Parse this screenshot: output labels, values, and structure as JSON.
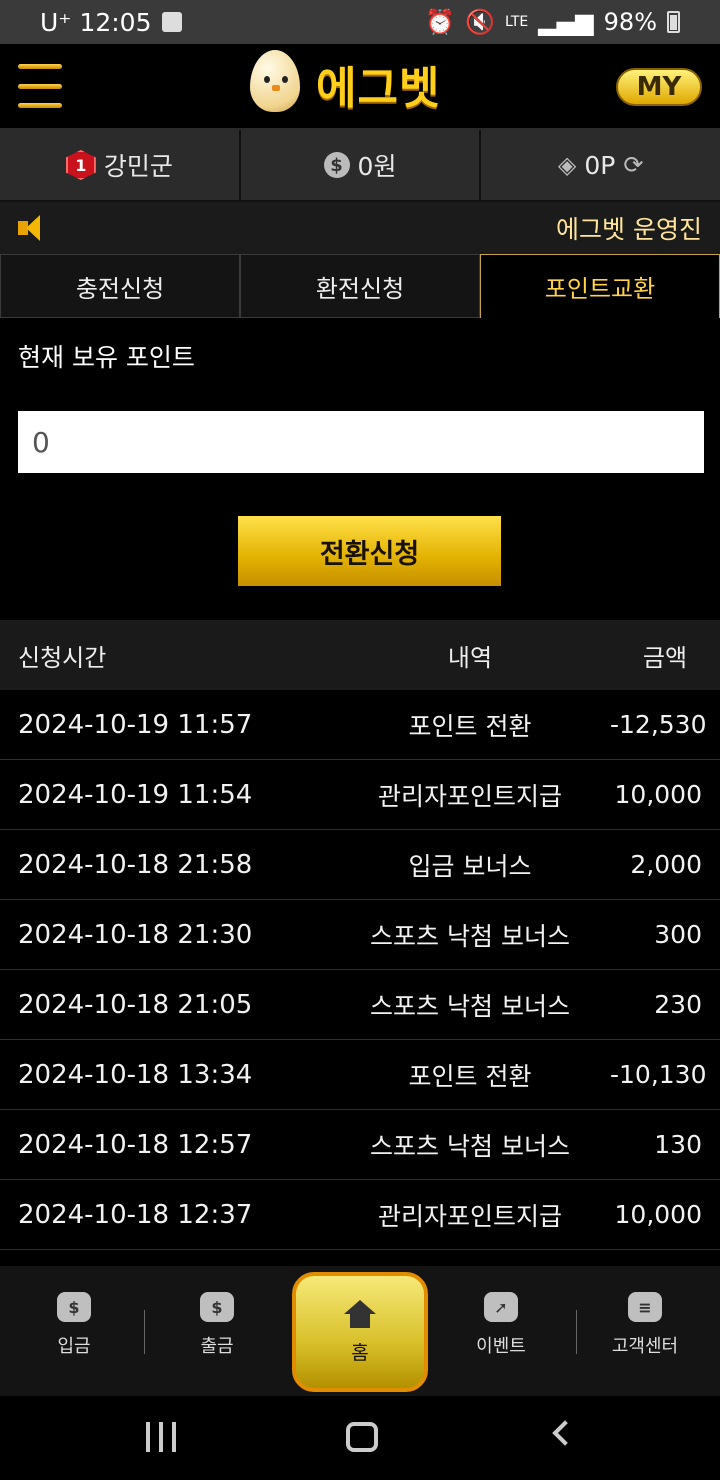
{
  "status_bar": {
    "carrier_time": "U⁺ 12:05",
    "network": "LTE",
    "battery": "98%"
  },
  "header": {
    "logo_text": "에그벳",
    "my_label": "MY"
  },
  "user_info": {
    "level": "1",
    "username": "강민군",
    "money": "0원",
    "points": "0P"
  },
  "notice": {
    "text": "에그벳 운영진"
  },
  "tabs": [
    {
      "label": "충전신청",
      "active": false
    },
    {
      "label": "환전신청",
      "active": false
    },
    {
      "label": "포인트교환",
      "active": true
    }
  ],
  "points_section": {
    "label": "현재 보유 포인트",
    "value": "0",
    "button_label": "전환신청"
  },
  "table": {
    "headers": [
      "신청시간",
      "내역",
      "금액"
    ],
    "rows": [
      {
        "date": "2024-10-19 11:57",
        "desc": "포인트 전환",
        "amount": "-12,530"
      },
      {
        "date": "2024-10-19 11:54",
        "desc": "관리자포인트지급",
        "amount": "10,000"
      },
      {
        "date": "2024-10-18 21:58",
        "desc": "입금 보너스",
        "amount": "2,000"
      },
      {
        "date": "2024-10-18 21:30",
        "desc": "스포츠 낙첨 보너스",
        "amount": "300"
      },
      {
        "date": "2024-10-18 21:05",
        "desc": "스포츠 낙첨 보너스",
        "amount": "230"
      },
      {
        "date": "2024-10-18 13:34",
        "desc": "포인트 전환",
        "amount": "-10,130"
      },
      {
        "date": "2024-10-18 12:57",
        "desc": "스포츠 낙첨 보너스",
        "amount": "130"
      },
      {
        "date": "2024-10-18 12:37",
        "desc": "관리자포인트지급",
        "amount": "10,000"
      }
    ]
  },
  "bottom_nav": {
    "deposit": "입금",
    "withdraw": "출금",
    "home": "홈",
    "event": "이벤트",
    "support": "고객센터"
  },
  "colors": {
    "accent_gold": "#ffcf1c",
    "background": "#000000"
  }
}
